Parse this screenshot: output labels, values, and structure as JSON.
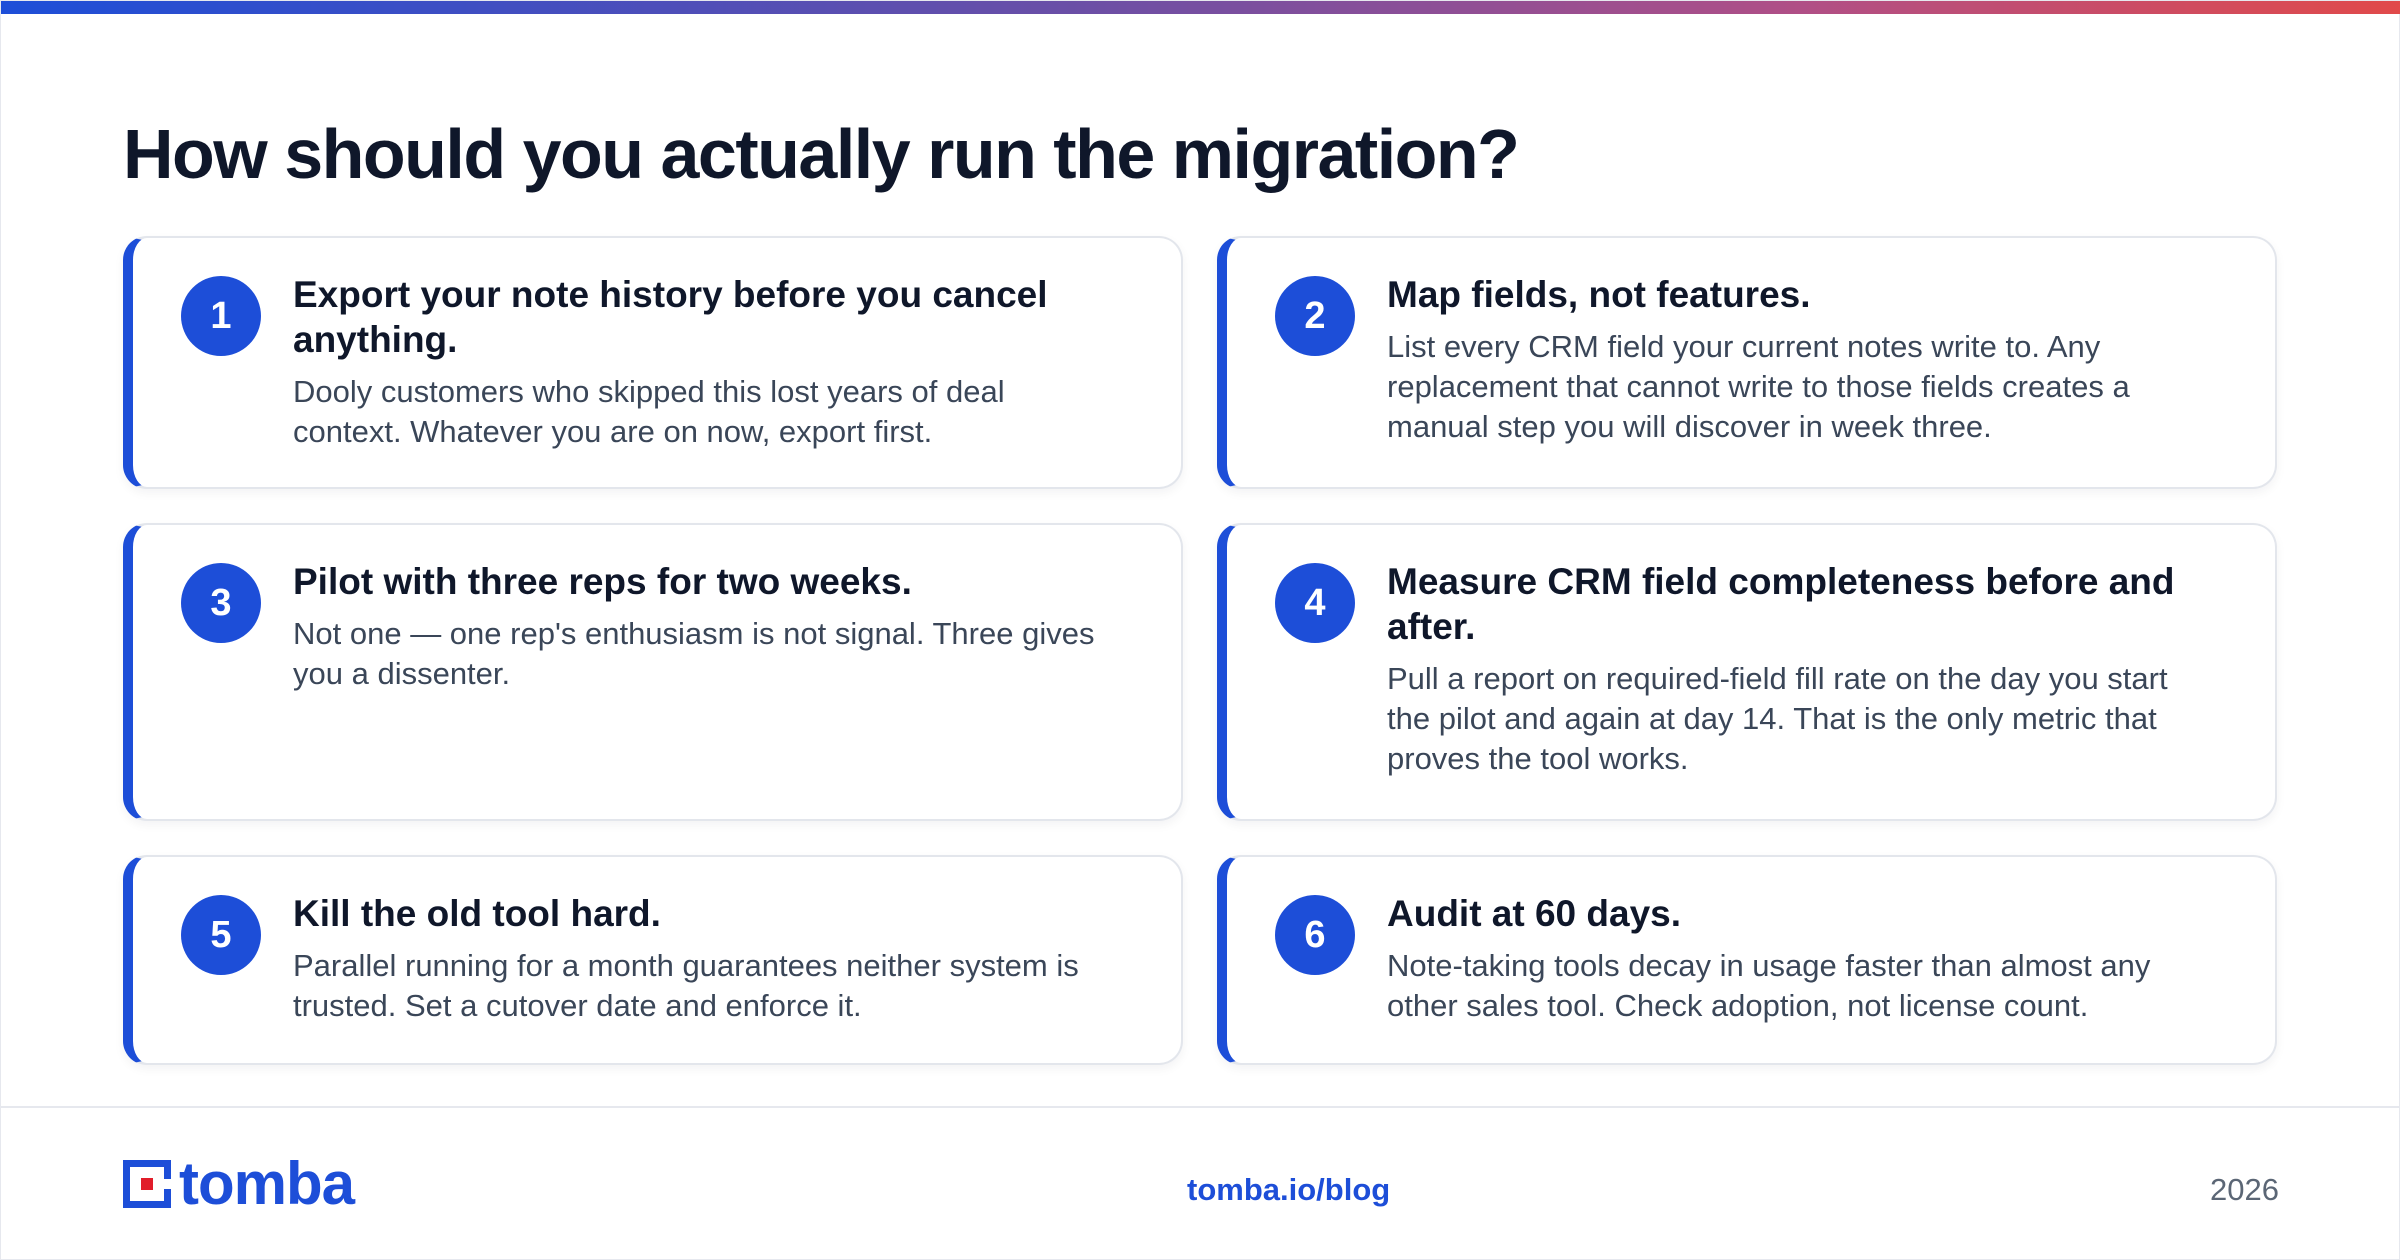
{
  "page_title": "How should you actually run the migration?",
  "steps": [
    {
      "number": "1",
      "title": "Export your note history before you cancel anything.",
      "text": "Dooly customers who skipped this lost years of deal context. Whatever you are on now, export first."
    },
    {
      "number": "2",
      "title": "Map fields, not features.",
      "text": "List every CRM field your current notes write to. Any replacement that cannot write to those fields creates a manual step you will discover in week three."
    },
    {
      "number": "3",
      "title": "Pilot with three reps for two weeks.",
      "text": "Not one — one rep's enthusiasm is not signal. Three gives you a dissenter."
    },
    {
      "number": "4",
      "title": "Measure CRM field completeness before and after.",
      "text": "Pull a report on required-field fill rate on the day you start the pilot and again at day 14. That is the only metric that proves the tool works."
    },
    {
      "number": "5",
      "title": "Kill the old tool hard.",
      "text": "Parallel running for a month guarantees neither system is trusted. Set a cutover date and enforce it."
    },
    {
      "number": "6",
      "title": "Audit at 60 days.",
      "text": "Note-taking tools decay in usage faster than almost any other sales tool. Check adoption, not license count."
    }
  ],
  "footer": {
    "logo_text": "tomba",
    "link": "tomba.io/blog",
    "year": "2026"
  },
  "colors": {
    "accent": "#1d4ed8",
    "logo_red": "#e11d2a",
    "title": "#0f172a",
    "body_text": "#3a4658",
    "gradient": [
      "#1d4ed8",
      "#6b4fa6",
      "#b04f86",
      "#e14a4a"
    ]
  }
}
